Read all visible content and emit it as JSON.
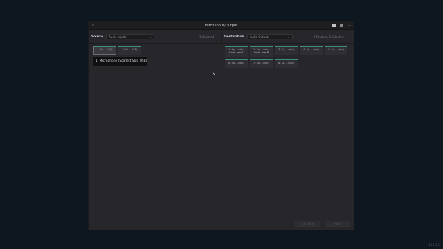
{
  "window": {
    "title": "Patch Input/Output",
    "close_glyph": "×",
    "tools": [
      {
        "icon": "grid-view-icon"
      },
      {
        "icon": "list-view-icon"
      },
      {
        "icon": "more-options-icon",
        "glyph": "···"
      }
    ]
  },
  "source": {
    "label": "Source",
    "dropdown_value": "Audio Inputs",
    "count": "1 Selected",
    "chips": [
      {
        "line1": "1: Mi... USB)",
        "selected": true
      },
      {
        "line1": "2: Mi... USB)",
        "selected": false
      }
    ],
    "tooltip": "1: Microphone (Scarlett Solo USB)"
  },
  "destination": {
    "label": "Destination",
    "dropdown_value": "Audio Outputs",
    "count": "2 Patched, 0 Selected",
    "chips": [
      {
        "line1": "1: Sp....udio)",
        "line2": "Cont...om-L"
      },
      {
        "line1": "2: Sp....udio)",
        "line2": "Cont...om-R"
      },
      {
        "line1": "3: Sp....udio)"
      },
      {
        "line1": "4: Sp....udio)"
      },
      {
        "line1": "5: Sp....udio)"
      },
      {
        "line1": "6: Sp....udio)"
      },
      {
        "line1": "7: Sp....udio)"
      },
      {
        "line1": "8: Sp....udio)"
      }
    ]
  },
  "buttons": {
    "unpatch": "Un-Patch",
    "patch": "Patch"
  },
  "watermark": "15.01.0",
  "icons": {
    "chevron": "chevron-down-icon",
    "dropdown_glyph": "⌄",
    "cursor": "mouse-pointer-icon",
    "cursor_glyph": "↖"
  },
  "colors": {
    "accent_teal": "#3f8e7f",
    "background": "#0e1620",
    "window": "#27272b"
  }
}
